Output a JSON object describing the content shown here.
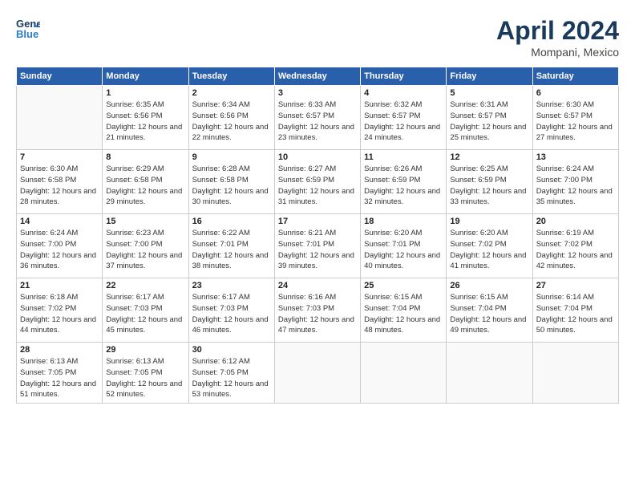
{
  "header": {
    "logo_line1": "General",
    "logo_line2": "Blue",
    "month": "April 2024",
    "location": "Mompani, Mexico"
  },
  "weekdays": [
    "Sunday",
    "Monday",
    "Tuesday",
    "Wednesday",
    "Thursday",
    "Friday",
    "Saturday"
  ],
  "weeks": [
    [
      {
        "day": null,
        "sunrise": null,
        "sunset": null,
        "daylight": null
      },
      {
        "day": "1",
        "sunrise": "6:35 AM",
        "sunset": "6:56 PM",
        "daylight": "12 hours and 21 minutes."
      },
      {
        "day": "2",
        "sunrise": "6:34 AM",
        "sunset": "6:56 PM",
        "daylight": "12 hours and 22 minutes."
      },
      {
        "day": "3",
        "sunrise": "6:33 AM",
        "sunset": "6:57 PM",
        "daylight": "12 hours and 23 minutes."
      },
      {
        "day": "4",
        "sunrise": "6:32 AM",
        "sunset": "6:57 PM",
        "daylight": "12 hours and 24 minutes."
      },
      {
        "day": "5",
        "sunrise": "6:31 AM",
        "sunset": "6:57 PM",
        "daylight": "12 hours and 25 minutes."
      },
      {
        "day": "6",
        "sunrise": "6:30 AM",
        "sunset": "6:57 PM",
        "daylight": "12 hours and 27 minutes."
      }
    ],
    [
      {
        "day": "7",
        "sunrise": "6:30 AM",
        "sunset": "6:58 PM",
        "daylight": "12 hours and 28 minutes."
      },
      {
        "day": "8",
        "sunrise": "6:29 AM",
        "sunset": "6:58 PM",
        "daylight": "12 hours and 29 minutes."
      },
      {
        "day": "9",
        "sunrise": "6:28 AM",
        "sunset": "6:58 PM",
        "daylight": "12 hours and 30 minutes."
      },
      {
        "day": "10",
        "sunrise": "6:27 AM",
        "sunset": "6:59 PM",
        "daylight": "12 hours and 31 minutes."
      },
      {
        "day": "11",
        "sunrise": "6:26 AM",
        "sunset": "6:59 PM",
        "daylight": "12 hours and 32 minutes."
      },
      {
        "day": "12",
        "sunrise": "6:25 AM",
        "sunset": "6:59 PM",
        "daylight": "12 hours and 33 minutes."
      },
      {
        "day": "13",
        "sunrise": "6:24 AM",
        "sunset": "7:00 PM",
        "daylight": "12 hours and 35 minutes."
      }
    ],
    [
      {
        "day": "14",
        "sunrise": "6:24 AM",
        "sunset": "7:00 PM",
        "daylight": "12 hours and 36 minutes."
      },
      {
        "day": "15",
        "sunrise": "6:23 AM",
        "sunset": "7:00 PM",
        "daylight": "12 hours and 37 minutes."
      },
      {
        "day": "16",
        "sunrise": "6:22 AM",
        "sunset": "7:01 PM",
        "daylight": "12 hours and 38 minutes."
      },
      {
        "day": "17",
        "sunrise": "6:21 AM",
        "sunset": "7:01 PM",
        "daylight": "12 hours and 39 minutes."
      },
      {
        "day": "18",
        "sunrise": "6:20 AM",
        "sunset": "7:01 PM",
        "daylight": "12 hours and 40 minutes."
      },
      {
        "day": "19",
        "sunrise": "6:20 AM",
        "sunset": "7:02 PM",
        "daylight": "12 hours and 41 minutes."
      },
      {
        "day": "20",
        "sunrise": "6:19 AM",
        "sunset": "7:02 PM",
        "daylight": "12 hours and 42 minutes."
      }
    ],
    [
      {
        "day": "21",
        "sunrise": "6:18 AM",
        "sunset": "7:02 PM",
        "daylight": "12 hours and 44 minutes."
      },
      {
        "day": "22",
        "sunrise": "6:17 AM",
        "sunset": "7:03 PM",
        "daylight": "12 hours and 45 minutes."
      },
      {
        "day": "23",
        "sunrise": "6:17 AM",
        "sunset": "7:03 PM",
        "daylight": "12 hours and 46 minutes."
      },
      {
        "day": "24",
        "sunrise": "6:16 AM",
        "sunset": "7:03 PM",
        "daylight": "12 hours and 47 minutes."
      },
      {
        "day": "25",
        "sunrise": "6:15 AM",
        "sunset": "7:04 PM",
        "daylight": "12 hours and 48 minutes."
      },
      {
        "day": "26",
        "sunrise": "6:15 AM",
        "sunset": "7:04 PM",
        "daylight": "12 hours and 49 minutes."
      },
      {
        "day": "27",
        "sunrise": "6:14 AM",
        "sunset": "7:04 PM",
        "daylight": "12 hours and 50 minutes."
      }
    ],
    [
      {
        "day": "28",
        "sunrise": "6:13 AM",
        "sunset": "7:05 PM",
        "daylight": "12 hours and 51 minutes."
      },
      {
        "day": "29",
        "sunrise": "6:13 AM",
        "sunset": "7:05 PM",
        "daylight": "12 hours and 52 minutes."
      },
      {
        "day": "30",
        "sunrise": "6:12 AM",
        "sunset": "7:05 PM",
        "daylight": "12 hours and 53 minutes."
      },
      {
        "day": null,
        "sunrise": null,
        "sunset": null,
        "daylight": null
      },
      {
        "day": null,
        "sunrise": null,
        "sunset": null,
        "daylight": null
      },
      {
        "day": null,
        "sunrise": null,
        "sunset": null,
        "daylight": null
      },
      {
        "day": null,
        "sunrise": null,
        "sunset": null,
        "daylight": null
      }
    ]
  ]
}
